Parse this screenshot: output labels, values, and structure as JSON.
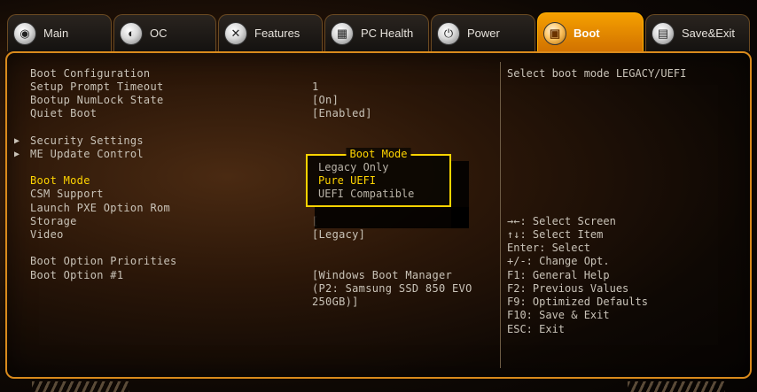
{
  "tabs": [
    {
      "label": "Main",
      "icon": "main-icon",
      "glyph": "◉"
    },
    {
      "label": "OC",
      "icon": "oc-icon",
      "glyph": "◐"
    },
    {
      "label": "Features",
      "icon": "features-icon",
      "glyph": "✕"
    },
    {
      "label": "PC Health",
      "icon": "pc-health-icon",
      "glyph": "▦"
    },
    {
      "label": "Power",
      "icon": "power-icon",
      "glyph": "⏻"
    },
    {
      "label": "Boot",
      "icon": "boot-icon",
      "glyph": "▣"
    },
    {
      "label": "Save&Exit",
      "icon": "save-exit-icon",
      "glyph": "▤"
    }
  ],
  "active_tab": "Boot",
  "settings": {
    "boot_configuration": "Boot Configuration",
    "setup_prompt_timeout": {
      "label": "Setup Prompt Timeout",
      "value": "1"
    },
    "bootup_numlock": {
      "label": "Bootup NumLock State",
      "value": "[On]"
    },
    "quiet_boot": {
      "label": "Quiet Boot",
      "value": "[Enabled]"
    },
    "security_settings": "Security Settings",
    "me_update_control": "ME Update Control",
    "boot_mode": {
      "label": "Boot Mode"
    },
    "csm_support": {
      "label": "CSM Support"
    },
    "launch_pxe": {
      "label": "Launch PXE Option Rom"
    },
    "storage": {
      "label": "Storage",
      "value": "["
    },
    "video": {
      "label": "Video",
      "value": "[Legacy]"
    },
    "boot_option_priorities": "Boot Option Priorities",
    "boot_option_1": {
      "label": "Boot Option #1",
      "value_lines": [
        "[Windows Boot Manager",
        "(P2: Samsung SSD 850 EVO",
        "250GB)]"
      ]
    }
  },
  "popup": {
    "title": "Boot Mode",
    "options": [
      "Legacy Only",
      "Pure UEFI",
      "UEFI Compatible"
    ],
    "selected": "Pure UEFI"
  },
  "help": {
    "description": "Select boot mode LEGACY/UEFI",
    "keys": [
      "→←: Select Screen",
      "↑↓: Select Item",
      "Enter: Select",
      "+/-: Change Opt.",
      "F1: General Help",
      "F2: Previous Values",
      "F9: Optimized Defaults",
      "F10: Save & Exit",
      "ESC: Exit"
    ]
  },
  "colors": {
    "accent": "#f59a00",
    "highlight": "#ffd400",
    "text": "#c9c3b8"
  }
}
